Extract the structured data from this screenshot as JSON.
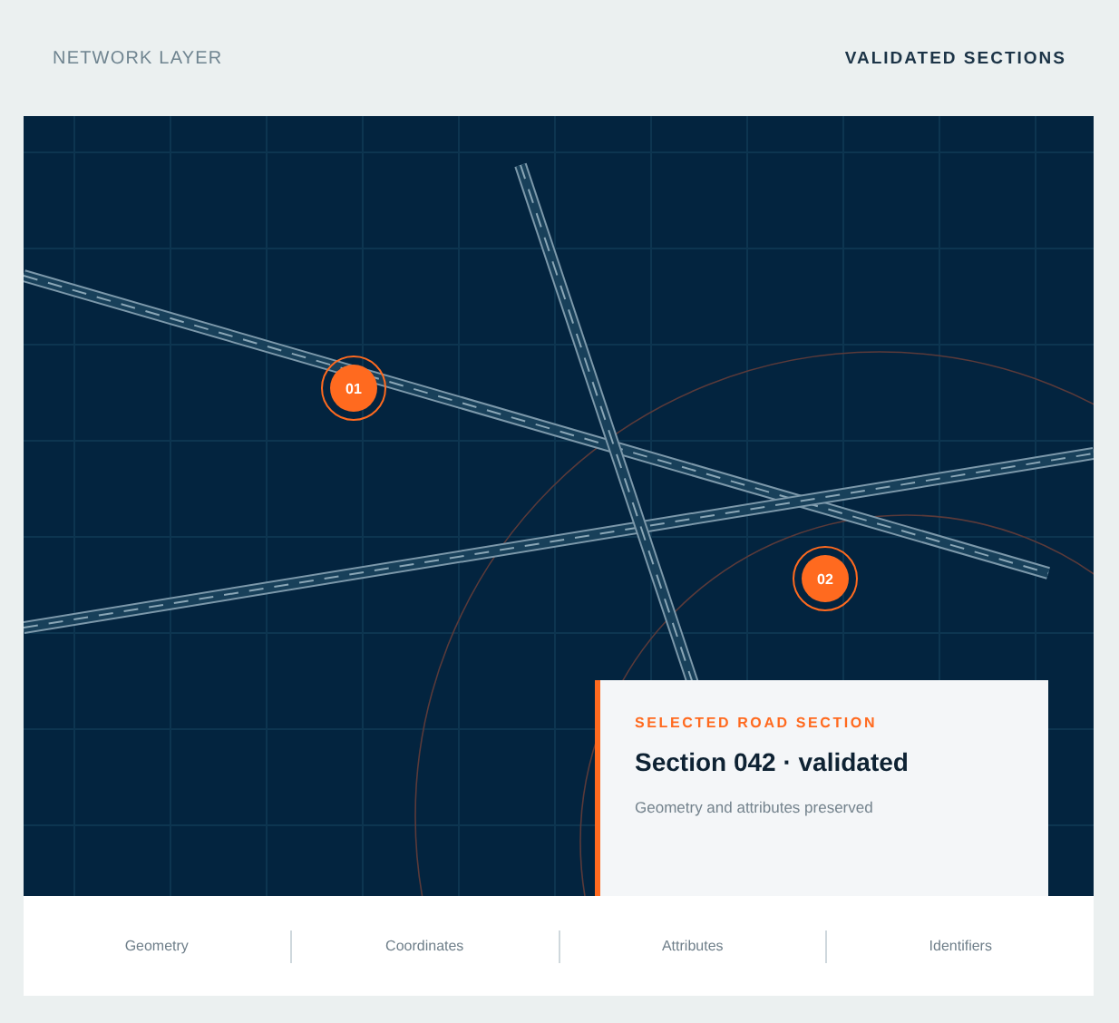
{
  "header": {
    "title": "NETWORK LAYER",
    "status": "VALIDATED SECTIONS"
  },
  "map": {
    "markers": [
      {
        "label": "01"
      },
      {
        "label": "02"
      }
    ],
    "selected_card": {
      "eyebrow": "SELECTED ROAD SECTION",
      "title": "Section 042 · validated",
      "description": "Geometry and attributes preserved"
    }
  },
  "footer": {
    "items": [
      "Geometry",
      "Coordinates",
      "Attributes",
      "Identifiers"
    ]
  }
}
